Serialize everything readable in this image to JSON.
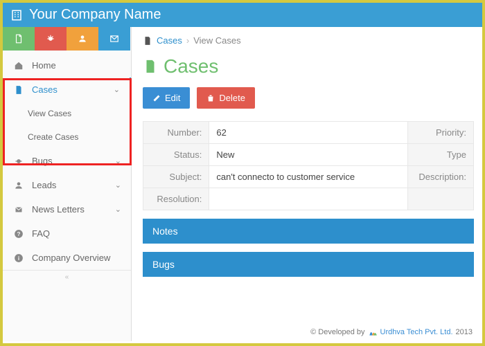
{
  "header": {
    "company_name": "Your Company Name"
  },
  "quickbar_icons": [
    "document-icon",
    "bug-icon",
    "user-icon",
    "mail-icon"
  ],
  "nav": {
    "home": "Home",
    "cases": "Cases",
    "view_cases": "View Cases",
    "create_cases": "Create Cases",
    "bugs": "Bugs",
    "leads": "Leads",
    "newsletters": "News Letters",
    "faq": "FAQ",
    "overview": "Company Overview"
  },
  "breadcrumb": {
    "root": "Cases",
    "current": "View Cases"
  },
  "page_title": "Cases",
  "actions": {
    "edit": "Edit",
    "delete": "Delete"
  },
  "fields": {
    "number_label": "Number:",
    "number_value": "62",
    "priority_label": "Priority:",
    "status_label": "Status:",
    "status_value": "New",
    "type_label": "Type",
    "subject_label": "Subject:",
    "subject_value": "can't connecto to customer service",
    "description_label": "Description:",
    "resolution_label": "Resolution:"
  },
  "panels": {
    "notes": "Notes",
    "bugs": "Bugs"
  },
  "footer": {
    "dev_by": "© Developed by",
    "company": "Urdhva Tech Pvt. Ltd.",
    "year": "2013"
  }
}
